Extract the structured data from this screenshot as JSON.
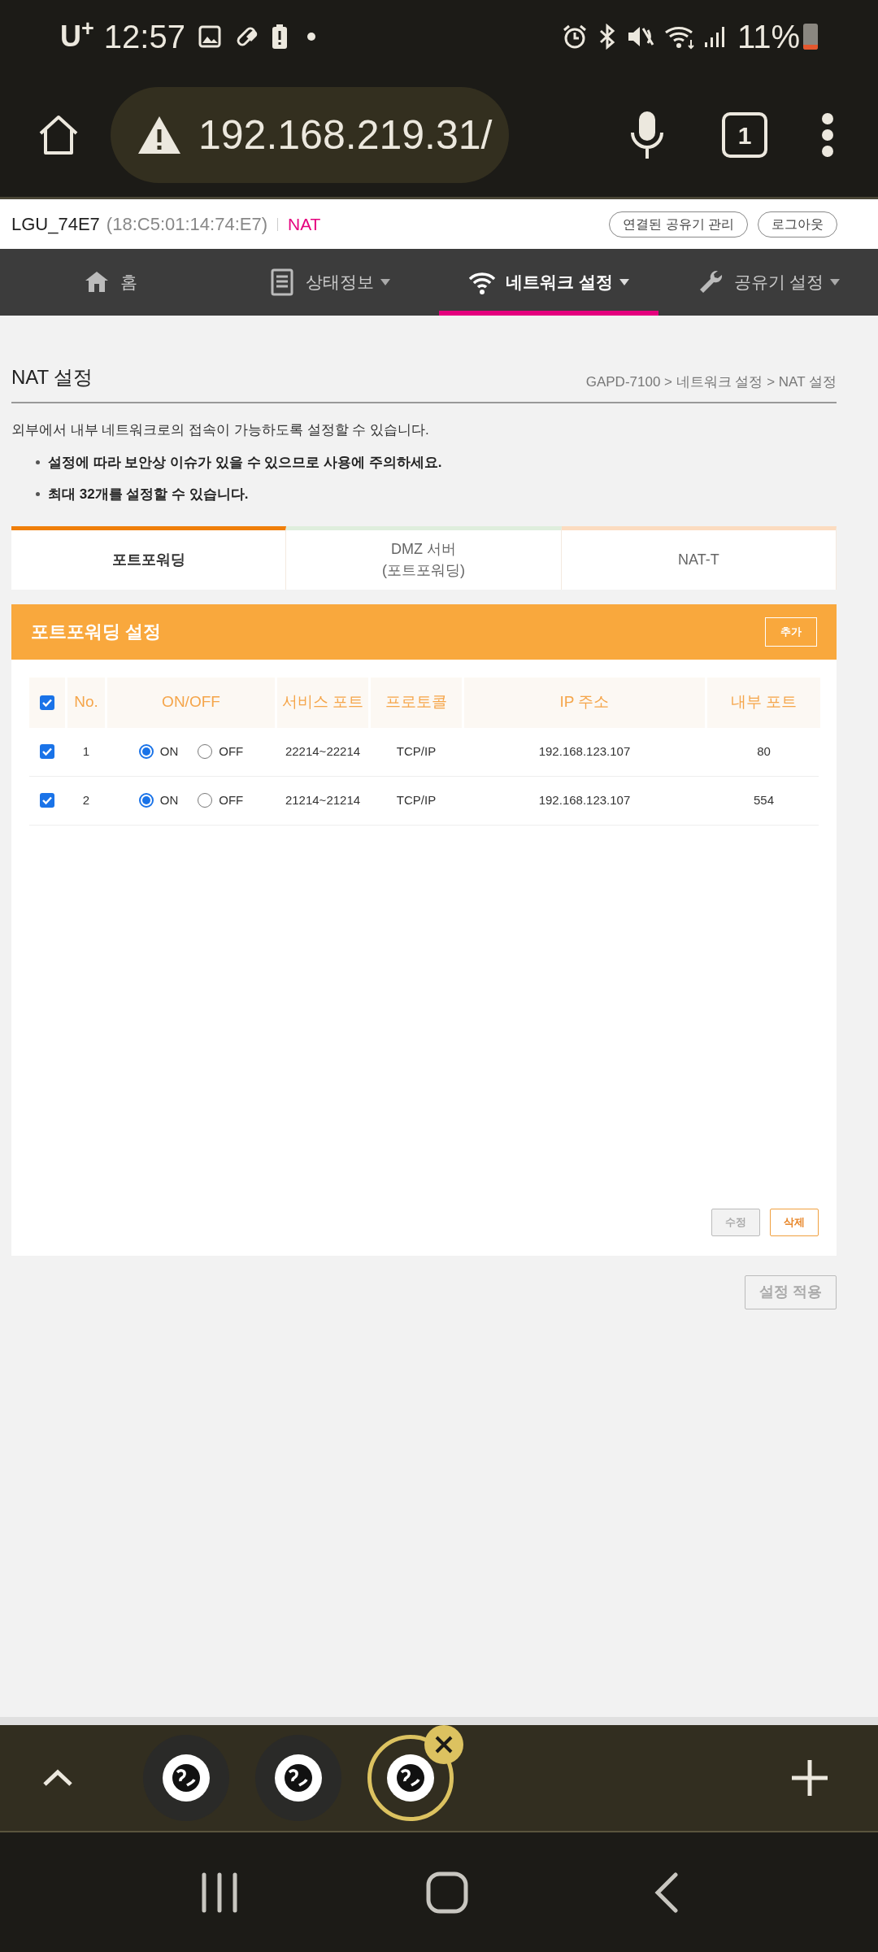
{
  "status_bar": {
    "carrier": "U$^{+}$",
    "time": "12:57",
    "battery": "11%"
  },
  "browser": {
    "url": "192.168.219.31/",
    "tab_count": "1"
  },
  "header": {
    "ssid": "LGU_74E7",
    "mac": "(18:C5:01:14:74:E7)",
    "mode": "NAT",
    "buttons": [
      "연결된 공유기 관리",
      "로그아웃"
    ]
  },
  "nav": [
    {
      "label": "홈",
      "kind": "home",
      "dropdown": false,
      "selected": false
    },
    {
      "label": "상태정보",
      "kind": "status",
      "dropdown": true,
      "selected": false
    },
    {
      "label": "네트워크 설정",
      "kind": "network",
      "dropdown": true,
      "selected": true
    },
    {
      "label": "공유기 설정",
      "kind": "router",
      "dropdown": true,
      "selected": false
    }
  ],
  "page": {
    "title": "NAT 설정",
    "breadcrumb": "GAPD-7100 > 네트워크 설정 > NAT 설정",
    "description": "외부에서 내부 네트워크로의 접속이 가능하도록 설정할 수 있습니다.",
    "notes": [
      "설정에 따라 보안상 이슈가 있을 수 있으므로 사용에 주의하세요.",
      "최대 32개를 설정할 수 있습니다."
    ]
  },
  "tabs": [
    {
      "label": "포트포워딩",
      "selected": true,
      "color": "#f07f0a"
    },
    {
      "label": "DMZ 서버\n(포트포워딩)",
      "selected": false,
      "color": "#dfeedd"
    },
    {
      "label": "NAT-T",
      "selected": false,
      "color": "#fcdcc0"
    }
  ],
  "panel": {
    "title": "포트포워딩 설정",
    "add_button": "추가",
    "columns": [
      "No.",
      "ON/OFF",
      "서비스 포트",
      "프로토콜",
      "IP 주소",
      "내부 포트"
    ],
    "select_all_checked": true,
    "rows": [
      {
        "checked": true,
        "no": "1",
        "on": true,
        "on_label": "ON",
        "off_label": "OFF",
        "service_port": "22214~22214",
        "protocol": "TCP/IP",
        "ip": "192.168.123.107",
        "internal_port": "80"
      },
      {
        "checked": true,
        "no": "2",
        "on": true,
        "on_label": "ON",
        "off_label": "OFF",
        "service_port": "21214~21214",
        "protocol": "TCP/IP",
        "ip": "192.168.123.107",
        "internal_port": "554"
      }
    ],
    "actions": [
      {
        "label": "수정",
        "disabled": true
      },
      {
        "label": "삭제",
        "disabled": false
      }
    ]
  },
  "apply_button": {
    "label": "설정 적용",
    "disabled": true
  },
  "browser_tabs": [
    {
      "selected": false
    },
    {
      "selected": false
    },
    {
      "selected": true
    }
  ]
}
